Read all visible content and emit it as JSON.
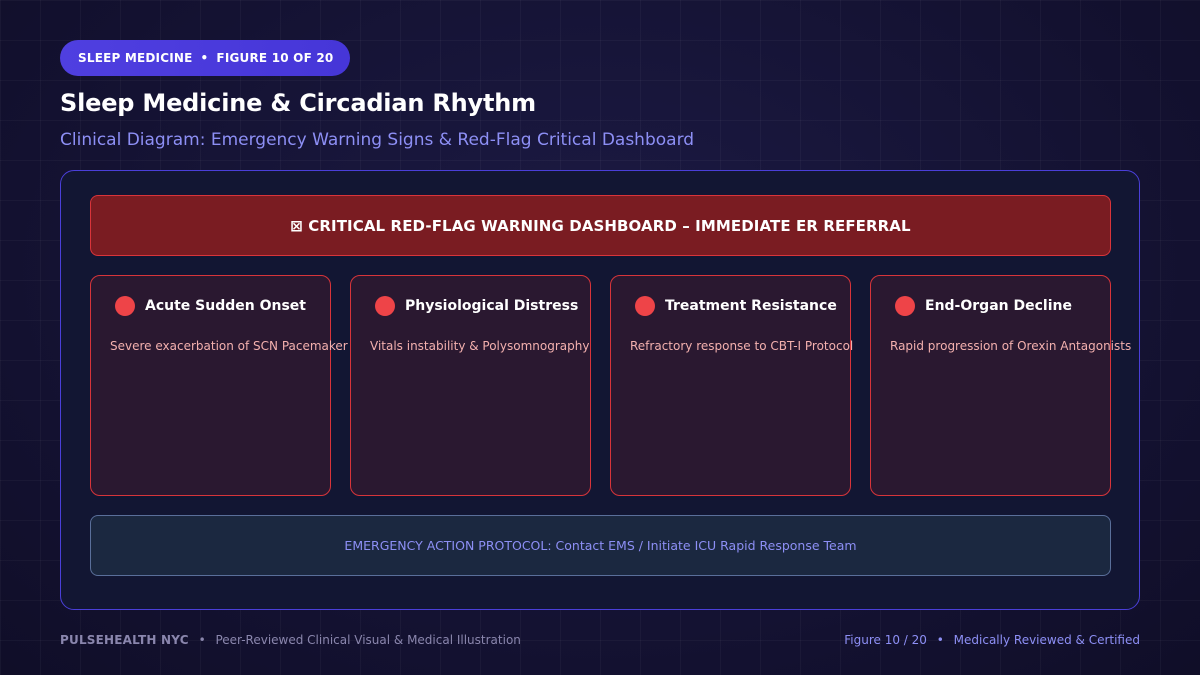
{
  "header": {
    "badge_category": "SLEEP MEDICINE",
    "badge_separator": "•",
    "badge_figure": "FIGURE 10 OF 20",
    "title": "Sleep Medicine & Circadian Rhythm",
    "subtitle": "Clinical Diagram: Emergency Warning Signs & Red-Flag Critical Dashboard"
  },
  "dashboard": {
    "alert_label": "⊠ CRITICAL RED-FLAG WARNING DASHBOARD – IMMEDIATE ER REFERRAL",
    "cards": [
      {
        "title": "Acute Sudden Onset",
        "description": "Severe exacerbation of SCN Pacemaker"
      },
      {
        "title": "Physiological Distress",
        "description": "Vitals instability & Polysomnography"
      },
      {
        "title": "Treatment Resistance",
        "description": "Refractory response to CBT-I Protocol"
      },
      {
        "title": "End-Organ Decline",
        "description": "Rapid progression of Orexin Antagonists"
      }
    ],
    "protocol_label": "EMERGENCY ACTION PROTOCOL: Contact EMS / Initiate ICU Rapid Response Team"
  },
  "footer": {
    "brand": "PULSEHEALTH NYC",
    "separator": "•",
    "tagline": "Peer-Reviewed Clinical Visual & Medical Illustration",
    "figure": "Figure 10 / 20",
    "certification": "Medically Reviewed & Certified"
  },
  "colors": {
    "accent": "#4f3fe0",
    "critical_red": "#d9343a",
    "indicator_red": "#ee4448",
    "subtitle_blue": "#8d8ff5"
  }
}
